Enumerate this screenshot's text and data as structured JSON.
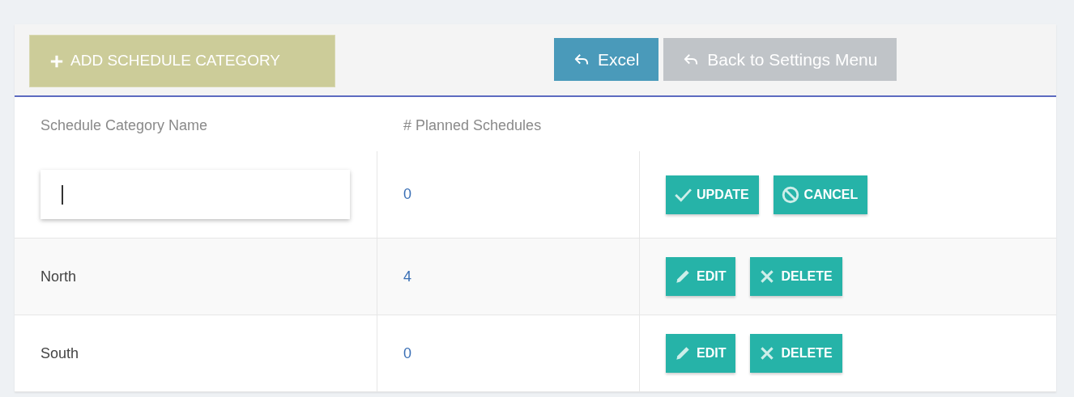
{
  "toolbar": {
    "add_button": {
      "label": "ADD SCHEDULE CATEGORY"
    },
    "buttons": [
      {
        "label": "Excel",
        "kind": "primary"
      },
      {
        "label": "Back to Settings Menu",
        "kind": "secondary"
      }
    ]
  },
  "table": {
    "columns": [
      "Schedule Category Name",
      "# Planned Schedules"
    ],
    "rows": [
      {
        "kind": "editing",
        "name": "",
        "count": "0",
        "actions": [
          {
            "label": "UPDATE",
            "kind": "update"
          },
          {
            "label": "CANCEL",
            "kind": "cancel"
          }
        ]
      },
      {
        "kind": "view",
        "name": "North",
        "count": "4",
        "actions": [
          {
            "label": "EDIT",
            "kind": "edit"
          },
          {
            "label": "DELETE",
            "kind": "delete"
          }
        ]
      },
      {
        "kind": "view",
        "name": "South",
        "count": "0",
        "actions": [
          {
            "label": "EDIT",
            "kind": "edit"
          },
          {
            "label": "DELETE",
            "kind": "delete"
          }
        ]
      }
    ]
  }
}
